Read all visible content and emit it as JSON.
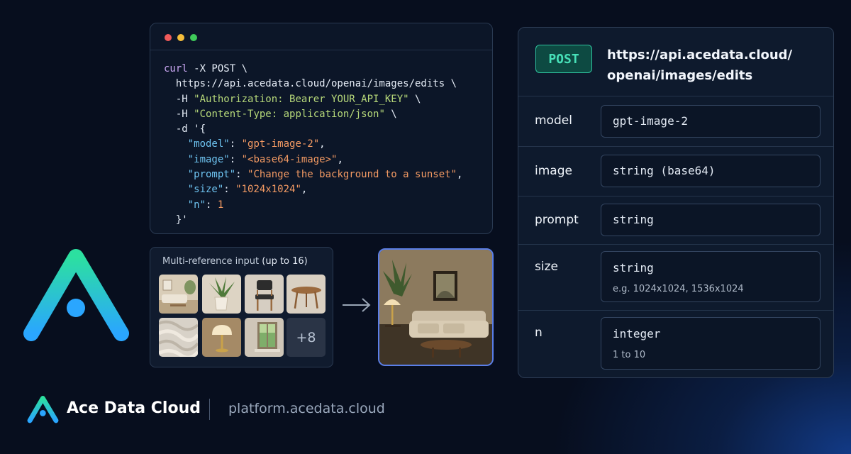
{
  "terminal": {
    "window_controls": [
      "close",
      "minimize",
      "maximize"
    ],
    "code": {
      "l1_cmd": "curl",
      "l1_rest": " -X POST \\",
      "l2": "  https://api.acedata.cloud/openai/images/edits \\",
      "l3_flag": "  -H ",
      "l3_str": "\"Authorization: Bearer YOUR_API_KEY\"",
      "l3_end": " \\",
      "l4_flag": "  -H ",
      "l4_str": "\"Content-Type: application/json\"",
      "l4_end": " \\",
      "l5": "  -d '{",
      "model_key": "\"model\"",
      "model_val": "\"gpt-image-2\"",
      "image_key": "\"image\"",
      "image_val": "\"<base64-image>\"",
      "prompt_key": "\"prompt\"",
      "prompt_val": "\"Change the background to a sunset\"",
      "size_key": "\"size\"",
      "size_val": "\"1024x1024\"",
      "n_key": "\"n\"",
      "n_val": "1",
      "close": "  }'"
    }
  },
  "refs": {
    "title": "Multi-reference input",
    "subtitle": "(up to 16)",
    "thumbnails": [
      "living-room",
      "plant",
      "chair",
      "table",
      "fabric",
      "lamp",
      "window"
    ],
    "more_label": "+8"
  },
  "panel": {
    "method": "POST",
    "endpoint_line1": "https://api.acedata.cloud/",
    "endpoint_line2": "openai/images/edits",
    "params": [
      {
        "name": "model",
        "value": "gpt-image-2",
        "hint": ""
      },
      {
        "name": "image",
        "value": "string (base64)",
        "hint": ""
      },
      {
        "name": "prompt",
        "value": "string",
        "hint": ""
      },
      {
        "name": "size",
        "value": "string",
        "hint": "e.g. 1024x1024, 1536x1024"
      },
      {
        "name": "n",
        "value": "integer",
        "hint": "1 to 10"
      }
    ]
  },
  "footer": {
    "brand": "Ace Data Cloud",
    "site": "platform.acedata.cloud"
  },
  "colors": {
    "background": "#070e1e",
    "post_green": "#47e0b8",
    "logo_top": "#2ce0a0",
    "logo_bottom": "#2aa6ff",
    "string_green": "#b7d97a",
    "key_blue": "#6ec3f0",
    "value_orange": "#f39a63"
  }
}
